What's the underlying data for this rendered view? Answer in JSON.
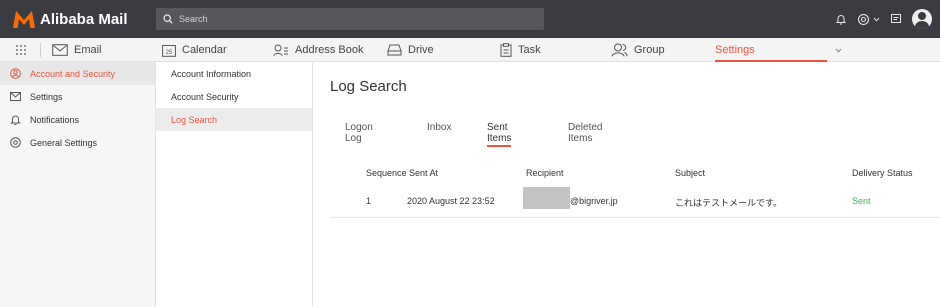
{
  "app": {
    "name": "Alibaba Mail",
    "brand_color": "#ff6a00"
  },
  "search": {
    "placeholder": "Search"
  },
  "nav": {
    "items": [
      {
        "label": "Email",
        "icon": "mail-icon"
      },
      {
        "label": "Calendar",
        "icon": "calendar-icon",
        "badge": "25"
      },
      {
        "label": "Address Book",
        "icon": "contacts-icon"
      },
      {
        "label": "Drive",
        "icon": "drive-icon"
      },
      {
        "label": "Task",
        "icon": "clipboard-icon"
      },
      {
        "label": "Group",
        "icon": "group-icon"
      },
      {
        "label": "Settings",
        "active": true
      }
    ]
  },
  "sidebar": {
    "items": [
      {
        "label": "Account and Security",
        "icon": "user-circle-icon",
        "active": true
      },
      {
        "label": "Settings",
        "icon": "envelope-icon"
      },
      {
        "label": "Notifications",
        "icon": "bell-icon"
      },
      {
        "label": "General Settings",
        "icon": "gear-icon"
      }
    ]
  },
  "submenu": {
    "items": [
      {
        "label": "Account Information"
      },
      {
        "label": "Account Security"
      },
      {
        "label": "Log Search",
        "active": true
      }
    ]
  },
  "main": {
    "title": "Log Search",
    "tabs": [
      {
        "label": "Logon Log"
      },
      {
        "label": "Inbox"
      },
      {
        "label": "Sent Items",
        "active": true
      },
      {
        "label": "Deleted Items"
      }
    ],
    "table": {
      "columns": [
        "Sequence",
        "Sent At",
        "Recipient",
        "Subject",
        "Delivery Status"
      ],
      "rows": [
        {
          "sequence": "1",
          "sent_at": "2020 August 22 23:52",
          "recipient": "@bigriver.jp",
          "subject": "これはテストメールです。",
          "status": "Sent",
          "status_color": "#3cb64a"
        }
      ]
    }
  },
  "colors": {
    "accent": "#e8563f",
    "topbar": "#3a3c41"
  }
}
